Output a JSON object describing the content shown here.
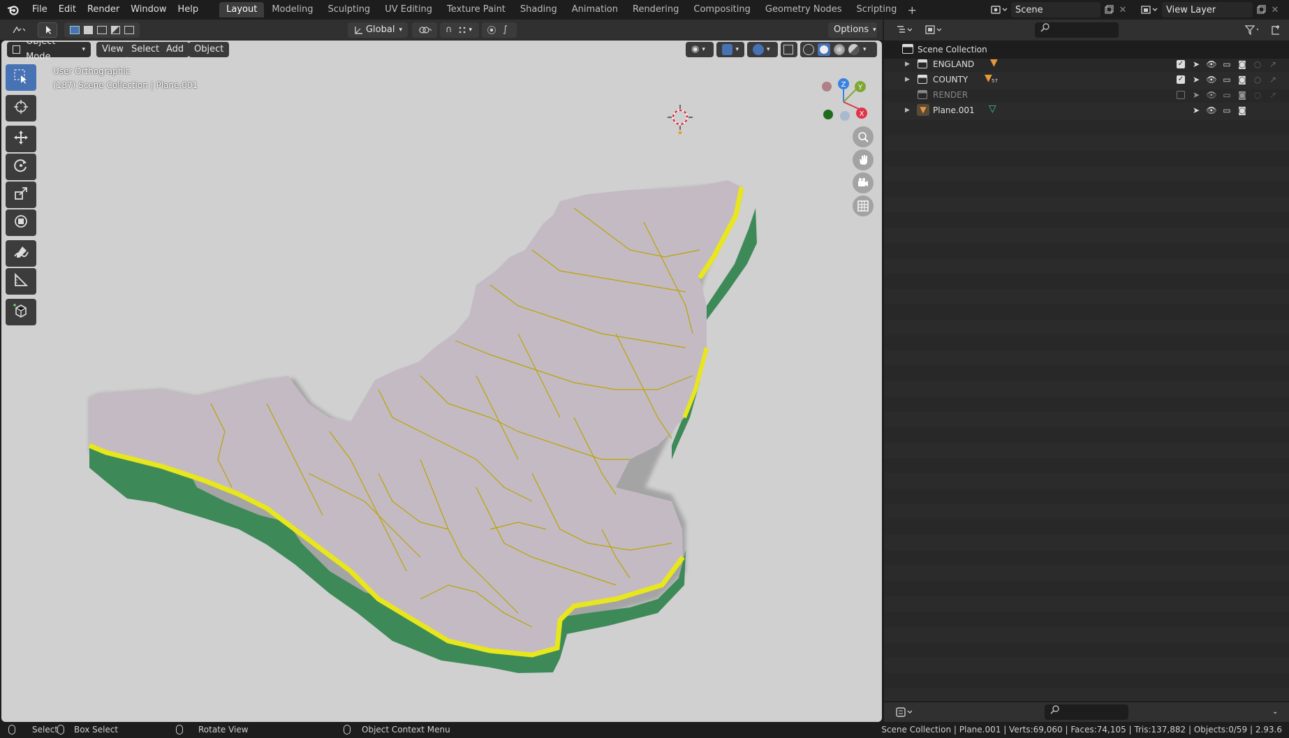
{
  "menu": [
    "File",
    "Edit",
    "Render",
    "Window",
    "Help"
  ],
  "workspaces": [
    "Layout",
    "Modeling",
    "Sculpting",
    "UV Editing",
    "Texture Paint",
    "Shading",
    "Animation",
    "Rendering",
    "Compositing",
    "Geometry Nodes",
    "Scripting"
  ],
  "active_workspace": "Layout",
  "scene": {
    "name": "Scene",
    "view_layer": "View Layer"
  },
  "viewport_header": {
    "transform_orientation": "Global",
    "options": "Options",
    "mode": "Object Mode",
    "view": "View",
    "select": "Select",
    "add": "Add",
    "object": "Object"
  },
  "viewport_info": {
    "line1": "User Orthographic",
    "line2": "(187) Scene Collection | Plane.001"
  },
  "gizmo_axes": {
    "z": "Z",
    "y": "Y",
    "x": "X"
  },
  "tools": [
    "select-box-icon",
    "cursor-icon",
    "move-icon",
    "rotate-icon",
    "scale-icon",
    "transform-icon",
    "annotate-icon",
    "measure-icon",
    "add-cube-icon"
  ],
  "outliner": {
    "root": "Scene Collection",
    "items": [
      {
        "name": "ENGLAND",
        "kind": "collection",
        "checked": true,
        "badge": ""
      },
      {
        "name": "COUNTY",
        "kind": "collection",
        "checked": true,
        "badge": "57"
      },
      {
        "name": "RENDER",
        "kind": "collection",
        "checked": false,
        "badge": ""
      },
      {
        "name": "Plane.001",
        "kind": "object",
        "checked": null,
        "badge": ""
      }
    ]
  },
  "status": {
    "select": "Select",
    "box_select": "Box Select",
    "rotate_view": "Rotate View",
    "context_menu": "Object Context Menu",
    "stats": "Scene Collection | Plane.001 | Verts:69,060 | Faces:74,105 | Tris:137,882 | Objects:0/59 | 2.93.6"
  },
  "colors": {
    "viewport_bg": "#d0d0d0",
    "map_fill": "#c4bac3",
    "border_yellow": "#e8e61c",
    "edge_green": "#3d8a58",
    "active_tool": "#4772b3",
    "axis_x": "#e0344b",
    "axis_y": "#7ea832",
    "axis_z": "#3a82e0"
  }
}
